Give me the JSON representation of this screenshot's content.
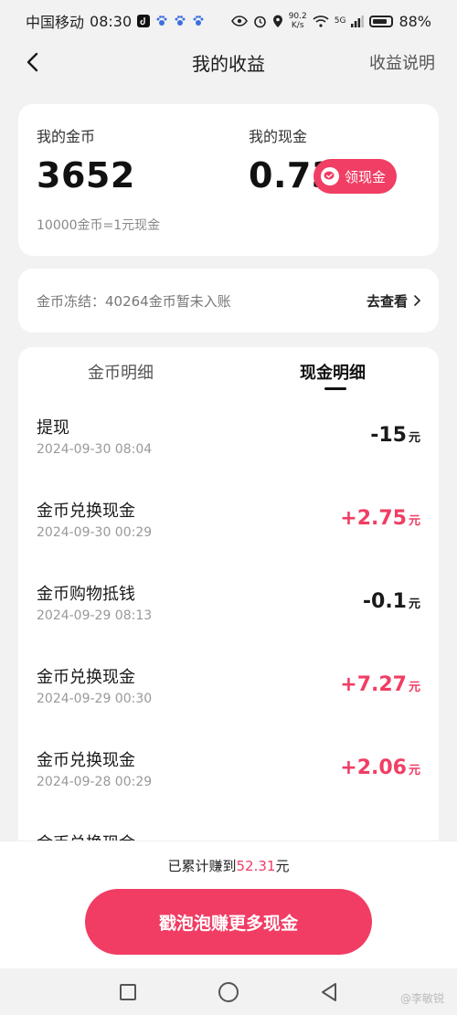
{
  "status_bar": {
    "carrier": "中国移动",
    "time": "08:30",
    "speed_value": "90.2",
    "speed_unit": "K/s",
    "network": "5G",
    "battery": "88%"
  },
  "header": {
    "title": "我的收益",
    "right_link": "收益说明"
  },
  "balance": {
    "coins_label": "我的金币",
    "coins_value": "3652",
    "cash_label": "我的现金",
    "cash_value": "0.73",
    "claim_label": "领现金",
    "rate_text": "10000金币=1元现金"
  },
  "frozen": {
    "text": "金币冻结：40264金币暂未入账",
    "link": "去查看"
  },
  "tabs": [
    {
      "label": "金币明细",
      "active": false
    },
    {
      "label": "现金明细",
      "active": true
    }
  ],
  "transactions": [
    {
      "title": "提现",
      "date": "2024-09-30 08:04",
      "amount": "-15",
      "unit": "元",
      "positive": false
    },
    {
      "title": "金币兑换现金",
      "date": "2024-09-30 00:29",
      "amount": "+2.75",
      "unit": "元",
      "positive": true
    },
    {
      "title": "金币购物抵钱",
      "date": "2024-09-29 08:13",
      "amount": "-0.1",
      "unit": "元",
      "positive": false
    },
    {
      "title": "金币兑换现金",
      "date": "2024-09-29 00:30",
      "amount": "+7.27",
      "unit": "元",
      "positive": true
    },
    {
      "title": "金币兑换现金",
      "date": "2024-09-28 00:29",
      "amount": "+2.06",
      "unit": "元",
      "positive": true
    },
    {
      "title": "金币兑换现金",
      "date": "",
      "amount": "",
      "unit": "",
      "positive": true
    }
  ],
  "bottom": {
    "earned_prefix": "已累计赚到",
    "earned_amount": "52.31",
    "earned_suffix": "元",
    "cta_label": "戳泡泡赚更多现金"
  },
  "watermark": "@李敏锐",
  "colors": {
    "accent": "#f03e64",
    "background": "#f2f2f2",
    "card": "#ffffff"
  }
}
